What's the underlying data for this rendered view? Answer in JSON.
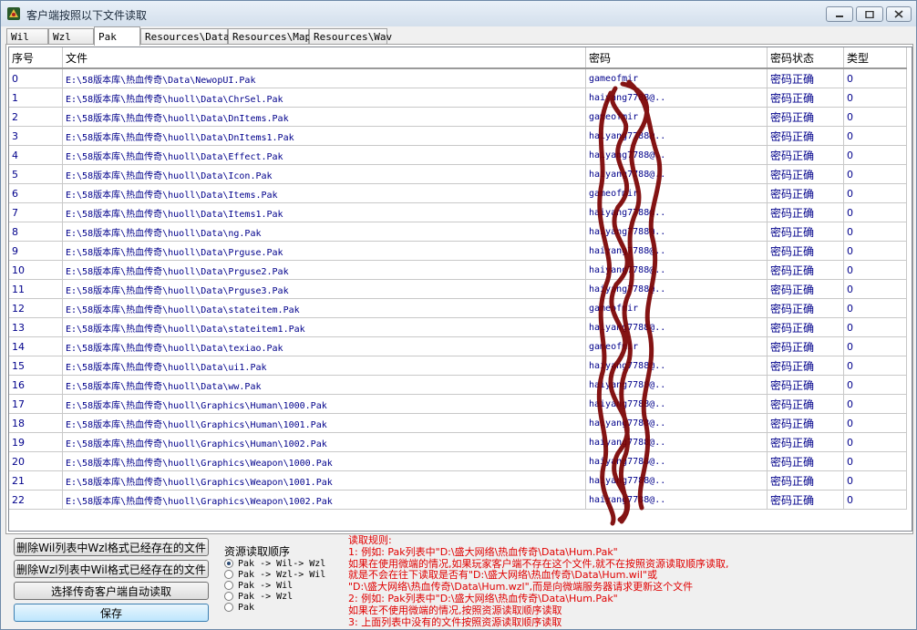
{
  "window": {
    "title": "客户端按照以下文件读取",
    "colors": {
      "accent": "#00008b",
      "rules": "#e00000",
      "scribble": "#7a0000"
    }
  },
  "tabs": [
    {
      "label": "Wil",
      "active": false
    },
    {
      "label": "Wzl",
      "active": false
    },
    {
      "label": "Pak",
      "active": true
    },
    {
      "label": "Resources\\Data",
      "active": false
    },
    {
      "label": "Resources\\Map",
      "active": false
    },
    {
      "label": "Resources\\Wav",
      "active": false
    }
  ],
  "table": {
    "headers": [
      "序号",
      "文件",
      "密码",
      "密码状态",
      "类型"
    ],
    "rows": [
      [
        "0",
        "E:\\58版本库\\热血传奇\\Data\\NewopUI.Pak",
        "gameofmir",
        "密码正确",
        "0"
      ],
      [
        "1",
        "E:\\58版本库\\热血传奇\\huoll\\Data\\ChrSel.Pak",
        "haiyang7788@..",
        "密码正确",
        "0"
      ],
      [
        "2",
        "E:\\58版本库\\热血传奇\\huoll\\Data\\DnItems.Pak",
        "gameofmir",
        "密码正确",
        "0"
      ],
      [
        "3",
        "E:\\58版本库\\热血传奇\\huoll\\Data\\DnItems1.Pak",
        "haiyang7788@..",
        "密码正确",
        "0"
      ],
      [
        "4",
        "E:\\58版本库\\热血传奇\\huoll\\Data\\Effect.Pak",
        "haiyang7788@..",
        "密码正确",
        "0"
      ],
      [
        "5",
        "E:\\58版本库\\热血传奇\\huoll\\Data\\Icon.Pak",
        "haiyang7788@..",
        "密码正确",
        "0"
      ],
      [
        "6",
        "E:\\58版本库\\热血传奇\\huoll\\Data\\Items.Pak",
        "gameofmir",
        "密码正确",
        "0"
      ],
      [
        "7",
        "E:\\58版本库\\热血传奇\\huoll\\Data\\Items1.Pak",
        "haiyang7788@..",
        "密码正确",
        "0"
      ],
      [
        "8",
        "E:\\58版本库\\热血传奇\\huoll\\Data\\ng.Pak",
        "haiyang7788@..",
        "密码正确",
        "0"
      ],
      [
        "9",
        "E:\\58版本库\\热血传奇\\huoll\\Data\\Prguse.Pak",
        "haiyang7788@..",
        "密码正确",
        "0"
      ],
      [
        "10",
        "E:\\58版本库\\热血传奇\\huoll\\Data\\Prguse2.Pak",
        "haiyang7788@..",
        "密码正确",
        "0"
      ],
      [
        "11",
        "E:\\58版本库\\热血传奇\\huoll\\Data\\Prguse3.Pak",
        "haiyang7788@..",
        "密码正确",
        "0"
      ],
      [
        "12",
        "E:\\58版本库\\热血传奇\\huoll\\Data\\stateitem.Pak",
        "gameofmir",
        "密码正确",
        "0"
      ],
      [
        "13",
        "E:\\58版本库\\热血传奇\\huoll\\Data\\stateitem1.Pak",
        "haiyang7788@..",
        "密码正确",
        "0"
      ],
      [
        "14",
        "E:\\58版本库\\热血传奇\\huoll\\Data\\texiao.Pak",
        "gameofmir",
        "密码正确",
        "0"
      ],
      [
        "15",
        "E:\\58版本库\\热血传奇\\huoll\\Data\\ui1.Pak",
        "haiyang7788@..",
        "密码正确",
        "0"
      ],
      [
        "16",
        "E:\\58版本库\\热血传奇\\huoll\\Data\\ww.Pak",
        "haiyang7788@..",
        "密码正确",
        "0"
      ],
      [
        "17",
        "E:\\58版本库\\热血传奇\\huoll\\Graphics\\Human\\1000.Pak",
        "haiyang7788@..",
        "密码正确",
        "0"
      ],
      [
        "18",
        "E:\\58版本库\\热血传奇\\huoll\\Graphics\\Human\\1001.Pak",
        "haiyang7788@..",
        "密码正确",
        "0"
      ],
      [
        "19",
        "E:\\58版本库\\热血传奇\\huoll\\Graphics\\Human\\1002.Pak",
        "haiyang7788@..",
        "密码正确",
        "0"
      ],
      [
        "20",
        "E:\\58版本库\\热血传奇\\huoll\\Graphics\\Weapon\\1000.Pak",
        "haiyang7788@..",
        "密码正确",
        "0"
      ],
      [
        "21",
        "E:\\58版本库\\热血传奇\\huoll\\Graphics\\Weapon\\1001.Pak",
        "haiyang7788@..",
        "密码正确",
        "0"
      ],
      [
        "22",
        "E:\\58版本库\\热血传奇\\huoll\\Graphics\\Weapon\\1002.Pak",
        "haiyang7788@..",
        "密码正确",
        "0"
      ]
    ]
  },
  "buttons": {
    "delete_wil": "删除Wil列表中Wzl格式已经存在的文件",
    "delete_wzl": "删除Wzl列表中Wil格式已经存在的文件",
    "select_client": "选择传奇客户端自动读取",
    "save": "保存"
  },
  "read_order": {
    "title": "资源读取顺序",
    "options": [
      {
        "label": "Pak -> Wil-> Wzl",
        "checked": true
      },
      {
        "label": "Pak -> Wzl-> Wil",
        "checked": false
      },
      {
        "label": "Pak -> Wil",
        "checked": false
      },
      {
        "label": "Pak -> Wzl",
        "checked": false
      },
      {
        "label": "Pak",
        "checked": false
      }
    ]
  },
  "rules": [
    "读取规则:",
    "1: 例如: Pak列表中\"D:\\盛大网络\\热血传奇\\Data\\Hum.Pak\"",
    "     如果在使用微端的情况,如果玩家客户端不存在这个文件,就不在按照资源读取顺序读取,",
    "     就是不会在往下读取是否有\"D:\\盛大网络\\热血传奇\\Data\\Hum.wil\"或",
    "   \"D:\\盛大网络\\热血传奇\\Data\\Hum.wzl\",而是向微端服务器请求更新这个文件",
    "2: 例如: Pak列表中\"D:\\盛大网络\\热血传奇\\Data\\Hum.Pak\"",
    "     如果在不使用微端的情况,按照资源读取顺序读取",
    "3: 上面列表中没有的文件按照资源读取顺序读取"
  ]
}
